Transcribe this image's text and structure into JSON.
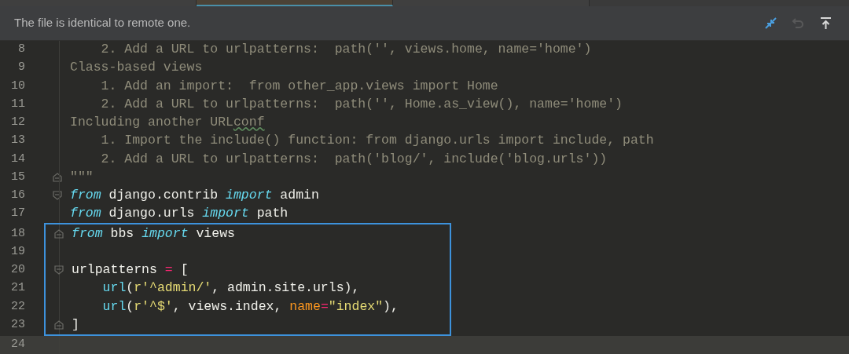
{
  "tabs": [
    {
      "selected": false
    },
    {
      "selected": true
    },
    {
      "selected": false
    }
  ],
  "notification": {
    "message": "The file is identical to remote one.",
    "actions": [
      {
        "kind": "sync",
        "disabled": false
      },
      {
        "kind": "revert",
        "disabled": true
      },
      {
        "kind": "push",
        "disabled": false
      }
    ]
  },
  "editor": {
    "sections": [
      {
        "boxed": false,
        "lines": [
          {
            "number": "8",
            "current": false,
            "tokens": [
              {
                "kind": "comment",
                "text": "    2. Add a URL to urlpatterns:  path('', views.home, name='home')"
              }
            ]
          },
          {
            "number": "9",
            "current": false,
            "tokens": [
              {
                "kind": "comment",
                "text": "Class-based views"
              }
            ]
          },
          {
            "number": "10",
            "current": false,
            "tokens": [
              {
                "kind": "comment",
                "text": "    1. Add an import:  from other_app.views import Home"
              }
            ]
          },
          {
            "number": "11",
            "current": false,
            "tokens": [
              {
                "kind": "comment",
                "text": "    2. Add a URL to urlpatterns:  path('', Home.as_view(), name='home')"
              }
            ]
          },
          {
            "number": "12",
            "current": false,
            "tokens": [
              {
                "kind": "comment",
                "text": "Including another URL"
              },
              {
                "kind": "comment_typo",
                "text": "conf"
              }
            ]
          },
          {
            "number": "13",
            "current": false,
            "tokens": [
              {
                "kind": "comment",
                "text": "    1. Import the include() function: from django.urls import include, path"
              }
            ]
          },
          {
            "number": "14",
            "current": false,
            "tokens": [
              {
                "kind": "comment",
                "text": "    2. Add a URL to urlpatterns:  path('blog/', include('blog.urls'))"
              }
            ]
          },
          {
            "number": "15",
            "current": false,
            "kind": "fold_end",
            "tokens": [
              {
                "kind": "comment",
                "text": "\"\"\""
              }
            ]
          },
          {
            "number": "16",
            "current": false,
            "kind": "fold_start",
            "tokens": [
              {
                "kind": "keyword",
                "text": "from"
              },
              {
                "kind": "plain",
                "text": " django.contrib "
              },
              {
                "kind": "keyword",
                "text": "import"
              },
              {
                "kind": "plain",
                "text": " admin"
              }
            ]
          },
          {
            "number": "17",
            "current": false,
            "tokens": [
              {
                "kind": "keyword",
                "text": "from"
              },
              {
                "kind": "plain",
                "text": " django.urls "
              },
              {
                "kind": "keyword",
                "text": "import"
              },
              {
                "kind": "plain",
                "text": " path"
              }
            ]
          }
        ]
      },
      {
        "boxed": true,
        "lines": [
          {
            "number": "18",
            "current": false,
            "kind": "fold_end",
            "tokens": [
              {
                "kind": "keyword",
                "text": "from"
              },
              {
                "kind": "plain",
                "text": " bbs "
              },
              {
                "kind": "keyword",
                "text": "import"
              },
              {
                "kind": "plain",
                "text": " views"
              }
            ]
          },
          {
            "number": "19",
            "current": false
          },
          {
            "number": "20",
            "current": false,
            "kind": "fold_start",
            "tokens": [
              {
                "kind": "plain",
                "text": "urlpatterns "
              },
              {
                "kind": "operator",
                "text": "="
              },
              {
                "kind": "plain",
                "text": " ["
              }
            ]
          },
          {
            "number": "21",
            "current": false,
            "tokens": [
              {
                "kind": "function",
                "text": "    url"
              },
              {
                "kind": "plain",
                "text": "("
              },
              {
                "kind": "string",
                "text": "r'^admin/'"
              },
              {
                "kind": "plain",
                "text": ", admin.site.urls),"
              }
            ]
          },
          {
            "number": "22",
            "current": false,
            "tokens": [
              {
                "kind": "function",
                "text": "    url"
              },
              {
                "kind": "plain",
                "text": "("
              },
              {
                "kind": "string",
                "text": "r'^$'"
              },
              {
                "kind": "plain",
                "text": ", views.index, "
              },
              {
                "kind": "param",
                "text": "name"
              },
              {
                "kind": "operator",
                "text": "="
              },
              {
                "kind": "string",
                "text": "\"index\""
              },
              {
                "kind": "plain",
                "text": "),"
              }
            ]
          },
          {
            "number": "23",
            "current": false,
            "kind": "fold_end",
            "tokens": [
              {
                "kind": "plain",
                "text": "]"
              }
            ]
          }
        ]
      },
      {
        "boxed": false,
        "lines": [
          {
            "number": "24",
            "current": true
          }
        ]
      }
    ]
  }
}
